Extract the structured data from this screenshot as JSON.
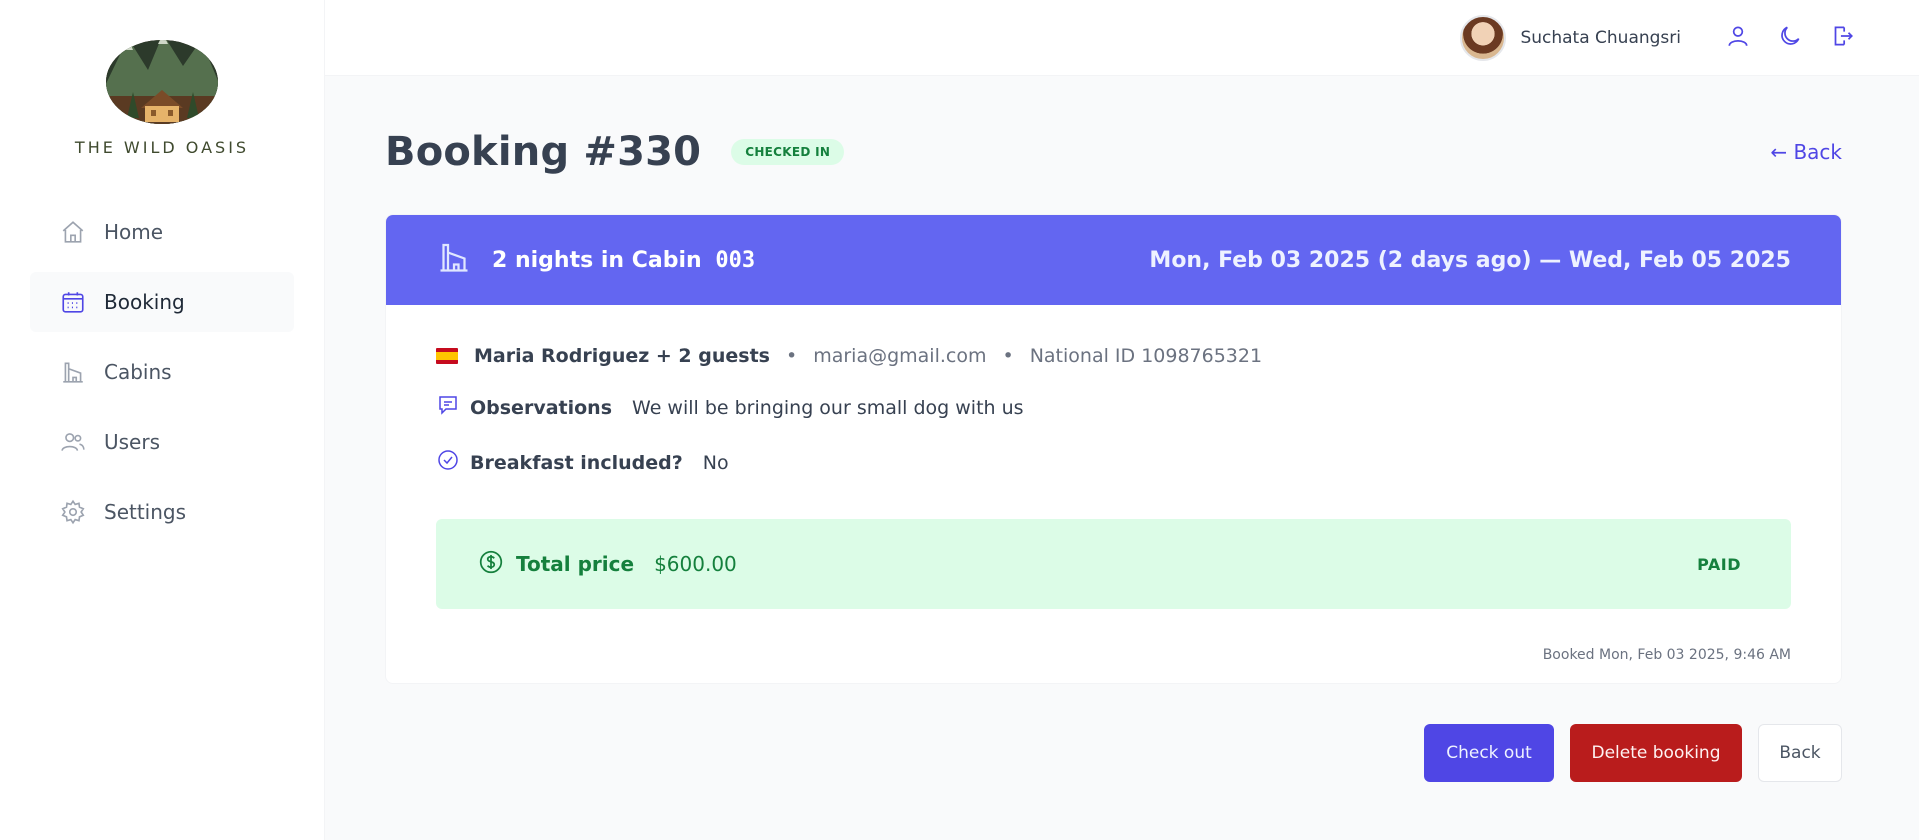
{
  "app": {
    "logo_text": "THE WILD OASIS"
  },
  "sidebar": {
    "items": [
      {
        "label": "Home",
        "icon": "home-icon"
      },
      {
        "label": "Booking",
        "icon": "calendar-icon",
        "active": true
      },
      {
        "label": "Cabins",
        "icon": "cabin-icon"
      },
      {
        "label": "Users",
        "icon": "users-icon"
      },
      {
        "label": "Settings",
        "icon": "gear-icon"
      }
    ]
  },
  "header": {
    "user_name": "Suchata Chuangsri",
    "buttons": [
      "account-icon",
      "dark-mode-icon",
      "logout-icon"
    ]
  },
  "booking": {
    "title": "Booking #330",
    "status": "CHECKED IN",
    "back_link": "← Back",
    "nights_text": "2 nights in Cabin",
    "cabin_code": "003",
    "dates": "Mon, Feb 03 2025 (2 days ago) — Wed, Feb 05 2025",
    "guest_name": "Maria Rodriguez + 2 guests",
    "guest_email": "maria@gmail.com",
    "national_id": "National ID 1098765321",
    "observations_label": "Observations",
    "observations_value": "We will be bringing our small dog with us",
    "breakfast_label": "Breakfast included?",
    "breakfast_value": "No",
    "total_label": "Total price",
    "total_value": "$600.00",
    "paid_status": "PAID",
    "booked_at": "Booked Mon, Feb 03 2025, 9:46 AM"
  },
  "actions": {
    "checkout": "Check out",
    "delete": "Delete booking",
    "back": "Back"
  },
  "colors": {
    "accent": "#4f46e5",
    "header_band": "#6366f1",
    "paid_bg": "#dcfce7",
    "paid_text": "#15803d",
    "danger": "#b91c1c"
  }
}
